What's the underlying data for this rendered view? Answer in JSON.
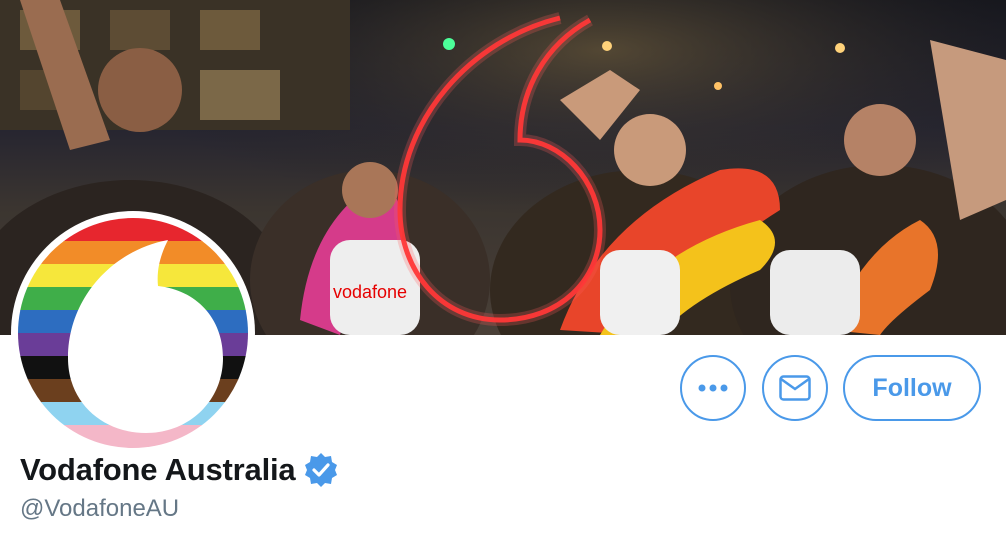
{
  "profile": {
    "display_name": "Vodafone Australia",
    "handle": "@VodafoneAU",
    "verified": true
  },
  "banner": {
    "shirt_text": "vodafone"
  },
  "avatar": {
    "stripes": [
      "#e7262e",
      "#f28c28",
      "#f6e73b",
      "#3fae49",
      "#2d6dc0",
      "#6a3d98",
      "#111111",
      "#6b3f1e",
      "#8fd3f0",
      "#f4b7c8"
    ]
  },
  "actions": {
    "more_icon": "ellipsis-icon",
    "mail_icon": "envelope-icon",
    "follow_label": "Follow"
  },
  "colors": {
    "accent": "#4a99e9",
    "name": "#14171a",
    "handle": "#657786",
    "vodafone_red": "#e60000"
  }
}
